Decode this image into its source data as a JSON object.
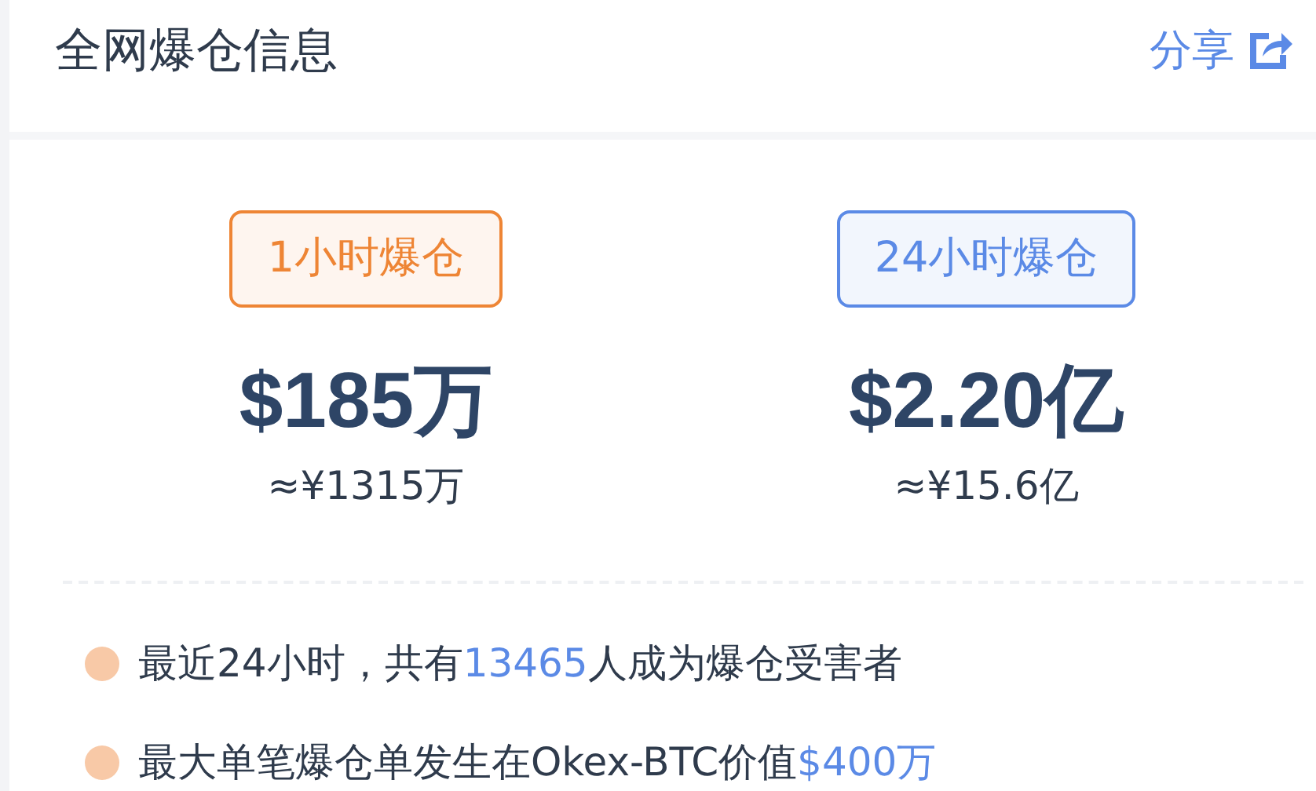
{
  "header": {
    "title": "全网爆仓信息",
    "share": "分享"
  },
  "stats": [
    {
      "label": "1小时爆仓",
      "color": "#ee8535",
      "amount": "$185万",
      "converted": "≈¥1315万"
    },
    {
      "label": "24小时爆仓",
      "color": "#5b8ae6",
      "amount": "$2.20亿",
      "converted": "≈¥15.6亿"
    }
  ],
  "facts": [
    {
      "parts": [
        {
          "text": "最近24小时，共有",
          "highlight": false
        },
        {
          "text": "13465",
          "highlight": true
        },
        {
          "text": "人成为爆仓受害者",
          "highlight": false
        }
      ]
    },
    {
      "parts": [
        {
          "text": "最大单笔爆仓单发生在Okex-BTC价值",
          "highlight": false
        },
        {
          "text": "$400万",
          "highlight": true
        }
      ]
    }
  ]
}
